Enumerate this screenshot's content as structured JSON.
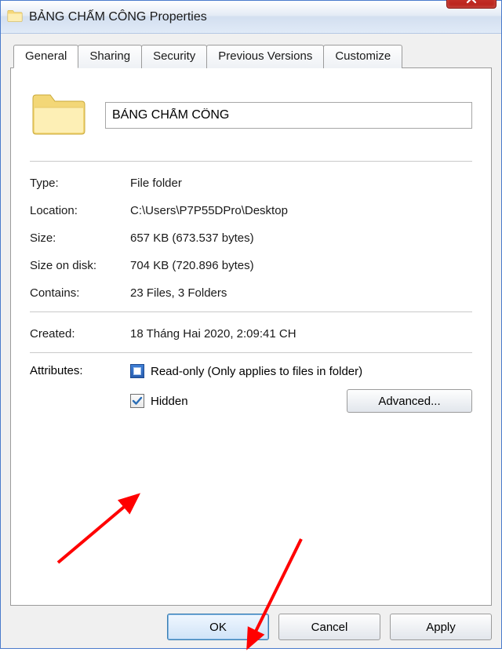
{
  "window": {
    "title": "BẢNG CHẤM CÔNG Properties"
  },
  "tabs": {
    "general": "General",
    "sharing": "Sharing",
    "security": "Security",
    "previous": "Previous Versions",
    "customize": "Customize"
  },
  "name_field": {
    "value": "BẢNG CHẤM CÔNG"
  },
  "labels": {
    "type": "Type:",
    "location": "Location:",
    "size": "Size:",
    "size_on_disk": "Size on disk:",
    "contains": "Contains:",
    "created": "Created:",
    "attributes": "Attributes:"
  },
  "values": {
    "type": "File folder",
    "location": "C:\\Users\\P7P55DPro\\Desktop",
    "size": "657 KB (673.537 bytes)",
    "size_on_disk": "704 KB (720.896 bytes)",
    "contains": "23 Files, 3 Folders",
    "created": "18 Tháng Hai 2020, 2:09:41 CH"
  },
  "attributes": {
    "readonly_label": "Read-only (Only applies to files in folder)",
    "hidden_label": "Hidden",
    "advanced_button": "Advanced..."
  },
  "buttons": {
    "ok": "OK",
    "cancel": "Cancel",
    "apply": "Apply"
  }
}
